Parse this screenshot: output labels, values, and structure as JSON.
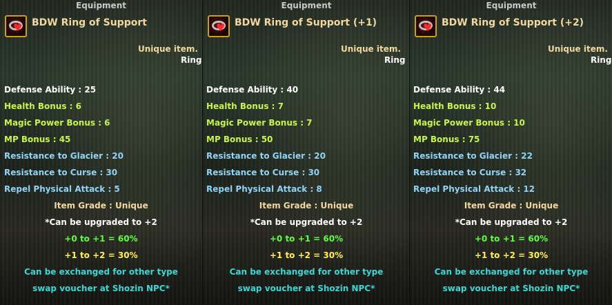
{
  "panels": [
    {
      "header": "Equipment",
      "item_icon": "heart-ring-icon",
      "title": "BDW Ring of Support",
      "unique": "Unique item.",
      "type": "Ring",
      "stats": {
        "defense": "Defense Ability : 25",
        "health": "Health Bonus : 6",
        "magic": "Magic Power Bonus : 6",
        "mp": "MP Bonus : 45",
        "glacier": "Resistance to Glacier : 20",
        "curse": "Resistance to Curse : 30",
        "repel": "Repel Physical Attack : 5"
      },
      "grade": "Item Grade : Unique",
      "upgrade": "*Can be upgraded to +2",
      "rate1": "+0 to +1 = 60%",
      "rate2": "+1 to +2 = 30%",
      "exchange1": "Can be exchanged for other type",
      "exchange2": "swap voucher at Shozin NPC*"
    },
    {
      "header": "Equipment",
      "item_icon": "heart-ring-icon",
      "title": "BDW Ring of Support (+1)",
      "unique": "Unique item.",
      "type": "Ring",
      "stats": {
        "defense": "Defense Ability : 40",
        "health": "Health Bonus : 7",
        "magic": "Magic Power Bonus : 7",
        "mp": "MP Bonus : 50",
        "glacier": "Resistance to Glacier : 20",
        "curse": "Resistance to Curse : 30",
        "repel": "Repel Physical Attack : 8"
      },
      "grade": "Item Grade : Unique",
      "upgrade": "*Can be upgraded to +2",
      "rate1": "+0 to +1 = 60%",
      "rate2": "+1 to +2 = 30%",
      "exchange1": "Can be exchanged for other type",
      "exchange2": "swap voucher at Shozin NPC*"
    },
    {
      "header": "Equipment",
      "item_icon": "heart-ring-icon",
      "title": "BDW Ring of Support (+2)",
      "unique": "Unique item.",
      "type": "Ring",
      "stats": {
        "defense": "Defense Ability : 44",
        "health": "Health Bonus : 10",
        "magic": "Magic Power Bonus : 10",
        "mp": "MP Bonus : 75",
        "glacier": "Resistance to Glacier : 22",
        "curse": "Resistance to Curse : 32",
        "repel": "Repel Physical Attack : 12"
      },
      "grade": "Item Grade : Unique",
      "upgrade": "*Can be upgraded to +2",
      "rate1": "+0 to +1 = 60%",
      "rate2": "+1 to +2 = 30%",
      "exchange1": "Can be exchanged for other type",
      "exchange2": "swap voucher at Shozin NPC*"
    }
  ],
  "colors": {
    "title": "#f0d8a0",
    "defense": "#ffffff",
    "bonus": "#c7f54a",
    "resist": "#8fd4f7",
    "rate1": "#5bff3a",
    "rate2": "#fff24a",
    "exchange": "#36d8d6"
  }
}
